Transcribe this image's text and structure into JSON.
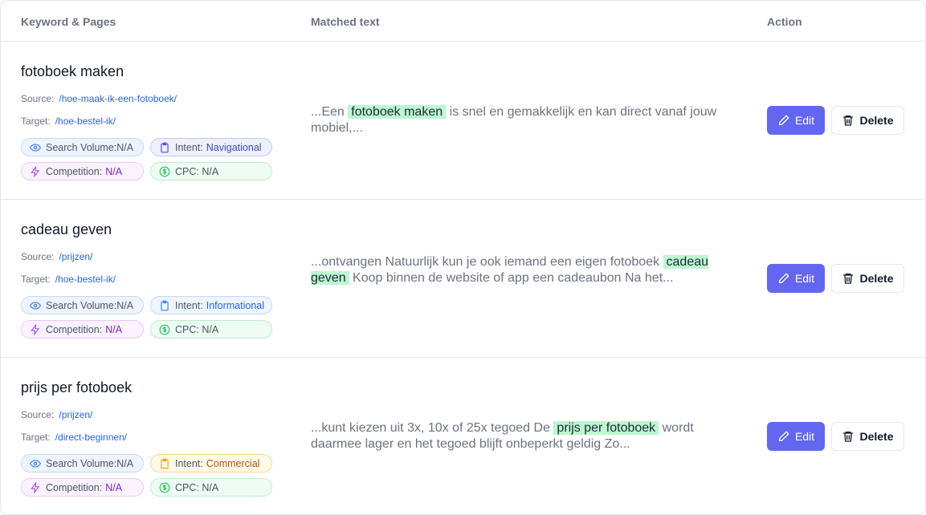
{
  "header": {
    "col_keyword": "Keyword & Pages",
    "col_matched": "Matched text",
    "col_action": "Action"
  },
  "labels": {
    "source": "Source:",
    "target": "Target:",
    "search_volume": "Search Volume:N/A",
    "intent": "Intent:",
    "competition": "Competition:",
    "cpc": "CPC: N/A",
    "edit": "Edit",
    "delete": "Delete"
  },
  "rows": [
    {
      "keyword": "fotoboek maken",
      "source": "/hoe-maak-ik-een-fotoboek/",
      "target": "/hoe-bestel-ik/",
      "intent": "Navigational",
      "competition": "N/A",
      "matched_before": "...Een",
      "matched_highlight": "fotoboek maken",
      "matched_after": "is snel en gemakkelijk en kan direct vanaf jouw mobiel,..."
    },
    {
      "keyword": "cadeau geven",
      "source": "/prijzen/",
      "target": "/hoe-bestel-ik/",
      "intent": "Informational",
      "competition": "N/A",
      "matched_before": "...ontvangen Natuurlijk kun je ook iemand een eigen fotoboek",
      "matched_highlight": "cadeau geven",
      "matched_after": "Koop binnen de website of app een cadeaubon Na het..."
    },
    {
      "keyword": "prijs per fotoboek",
      "source": "/prijzen/",
      "target": "/direct-beginnen/",
      "intent": "Commercial",
      "competition": "N/A",
      "matched_before": "...kunt kiezen uit 3x, 10x of 25x tegoed De",
      "matched_highlight": "prijs per fotoboek",
      "matched_after": "wordt daarmee lager en het tegoed blijft onbeperkt geldig Zo..."
    }
  ],
  "colors": {
    "accent": "#6366f1",
    "highlight": "#bbf7d0",
    "link": "#2563eb"
  },
  "icons": {
    "search_volume": "eye-icon",
    "intent": "clipboard-icon",
    "competition": "lightning-icon",
    "cpc": "dollar-circle-icon",
    "edit": "pencil-icon",
    "delete": "trash-icon"
  }
}
